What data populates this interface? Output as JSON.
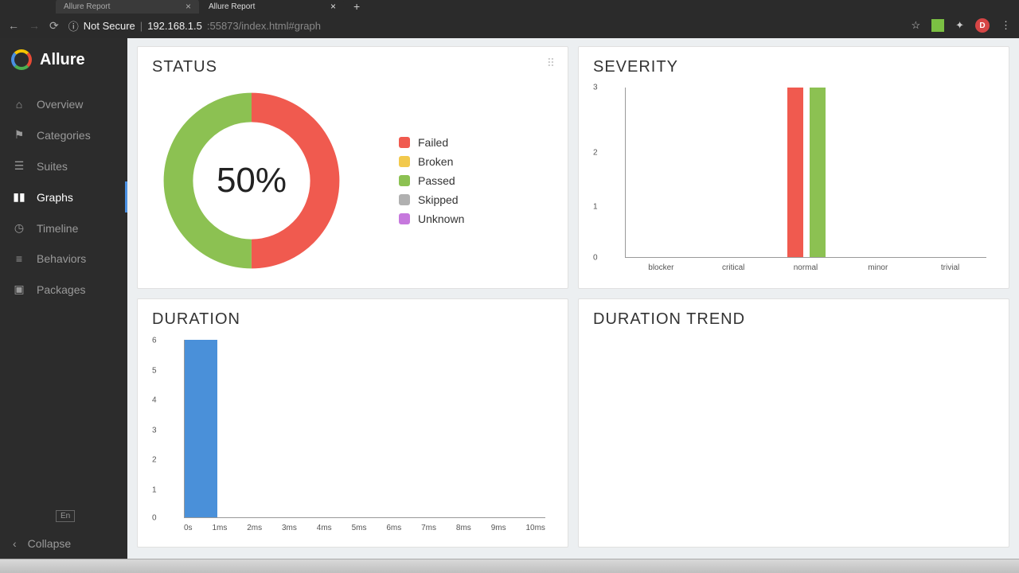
{
  "browser": {
    "tabs": [
      {
        "title": "Allure Report"
      },
      {
        "title": "Allure Report"
      }
    ],
    "not_secure_label": "Not Secure",
    "host": "192.168.1.5",
    "port_path": ":55873/index.html#graph",
    "avatar_letter": "D"
  },
  "sidebar": {
    "brand": "Allure",
    "items": [
      {
        "label": "Overview",
        "icon": "home"
      },
      {
        "label": "Categories",
        "icon": "flag"
      },
      {
        "label": "Suites",
        "icon": "briefcase"
      },
      {
        "label": "Graphs",
        "icon": "bar-chart",
        "active": true
      },
      {
        "label": "Timeline",
        "icon": "clock"
      },
      {
        "label": "Behaviors",
        "icon": "list"
      },
      {
        "label": "Packages",
        "icon": "package"
      }
    ],
    "lang": "En",
    "collapse": "Collapse"
  },
  "cards": {
    "status": {
      "title": "STATUS",
      "center": "50%",
      "legend": [
        {
          "label": "Failed",
          "color": "#f05a4f"
        },
        {
          "label": "Broken",
          "color": "#f2c94c"
        },
        {
          "label": "Passed",
          "color": "#8cc152"
        },
        {
          "label": "Skipped",
          "color": "#b0b0b0"
        },
        {
          "label": "Unknown",
          "color": "#c678dd"
        }
      ]
    },
    "severity": {
      "title": "SEVERITY"
    },
    "duration": {
      "title": "DURATION"
    },
    "duration_trend": {
      "title": "DURATION TREND"
    }
  },
  "chart_data": [
    {
      "id": "status",
      "type": "pie",
      "title": "STATUS",
      "series": [
        {
          "name": "Failed",
          "value": 3,
          "color": "#f05a4f"
        },
        {
          "name": "Broken",
          "value": 0,
          "color": "#f2c94c"
        },
        {
          "name": "Passed",
          "value": 3,
          "color": "#8cc152"
        },
        {
          "name": "Skipped",
          "value": 0,
          "color": "#b0b0b0"
        },
        {
          "name": "Unknown",
          "value": 0,
          "color": "#c678dd"
        }
      ],
      "center_label": "50%"
    },
    {
      "id": "severity",
      "type": "bar",
      "title": "SEVERITY",
      "categories": [
        "blocker",
        "critical",
        "normal",
        "minor",
        "trivial"
      ],
      "series": [
        {
          "name": "Failed",
          "color": "#f05a4f",
          "values": [
            0,
            0,
            3,
            0,
            0
          ]
        },
        {
          "name": "Passed",
          "color": "#8cc152",
          "values": [
            0,
            0,
            3,
            0,
            0
          ]
        }
      ],
      "ylim": [
        0,
        3
      ],
      "yticks": [
        0,
        1,
        2,
        3
      ]
    },
    {
      "id": "duration",
      "type": "bar",
      "title": "DURATION",
      "categories": [
        "0s",
        "1ms",
        "2ms",
        "3ms",
        "4ms",
        "5ms",
        "6ms",
        "7ms",
        "8ms",
        "9ms",
        "10ms"
      ],
      "values": [
        6,
        0,
        0,
        0,
        0,
        0,
        0,
        0,
        0,
        0,
        0
      ],
      "ylim": [
        0,
        6
      ],
      "yticks": [
        0,
        1,
        2,
        3,
        4,
        5,
        6
      ],
      "bar_color": "#4a90d9"
    },
    {
      "id": "duration_trend",
      "type": "line",
      "title": "DURATION TREND",
      "series": []
    }
  ]
}
